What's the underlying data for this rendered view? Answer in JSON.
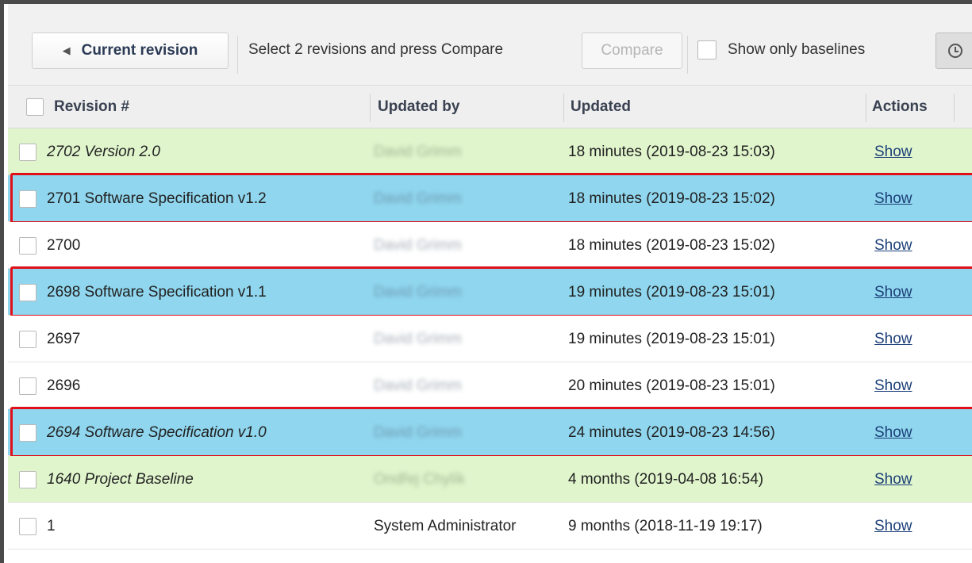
{
  "toolbar": {
    "current_revision_label": "Current revision",
    "hint": "Select 2 revisions and press Compare",
    "compare_label": "Compare",
    "show_only_baselines_label": "Show only baselines"
  },
  "table": {
    "columns": [
      "Revision #",
      "Updated by",
      "Updated",
      "Actions"
    ],
    "rows": [
      {
        "revision": "2702 Version 2.0",
        "updated_by": "David Grimm",
        "updated": "18 minutes (2019-08-23 15:03)",
        "action": "Show",
        "style": "green",
        "italic": true,
        "highlighted": false
      },
      {
        "revision": "2701 Software Specification v1.2",
        "updated_by": "David Grimm",
        "updated": "18 minutes (2019-08-23 15:02)",
        "action": "Show",
        "style": "blue",
        "italic": false,
        "highlighted": true
      },
      {
        "revision": "2700",
        "updated_by": "David Grimm",
        "updated": "18 minutes (2019-08-23 15:02)",
        "action": "Show",
        "style": "white",
        "italic": false,
        "highlighted": false
      },
      {
        "revision": "2698 Software Specification v1.1",
        "updated_by": "David Grimm",
        "updated": "19 minutes (2019-08-23 15:01)",
        "action": "Show",
        "style": "blue",
        "italic": false,
        "highlighted": true
      },
      {
        "revision": "2697",
        "updated_by": "David Grimm",
        "updated": "19 minutes (2019-08-23 15:01)",
        "action": "Show",
        "style": "white",
        "italic": false,
        "highlighted": false
      },
      {
        "revision": "2696",
        "updated_by": "David Grimm",
        "updated": "20 minutes (2019-08-23 15:01)",
        "action": "Show",
        "style": "white",
        "italic": false,
        "highlighted": false
      },
      {
        "revision": "2694 Software Specification v1.0",
        "updated_by": "David Grimm",
        "updated": "24 minutes (2019-08-23 14:56)",
        "action": "Show",
        "style": "blue",
        "italic": true,
        "highlighted": true
      },
      {
        "revision": "1640 Project Baseline",
        "updated_by": "Ondřej Chylík",
        "updated": "4 months (2019-04-08 16:54)",
        "action": "Show",
        "style": "green",
        "italic": true,
        "highlighted": false
      },
      {
        "revision": "1",
        "updated_by": "System Administrator",
        "updated": "9 months (2018-11-19 19:17)",
        "action": "Show",
        "style": "white",
        "italic": false,
        "highlighted": false
      }
    ]
  },
  "colors": {
    "baseline_row": "#e0f5cc",
    "selected_row": "#8fd6ee",
    "highlight_border": "#e0101a",
    "link": "#1c3f78"
  },
  "icons": {
    "current_revision": "triangle-left-icon",
    "history": "clock-icon"
  }
}
